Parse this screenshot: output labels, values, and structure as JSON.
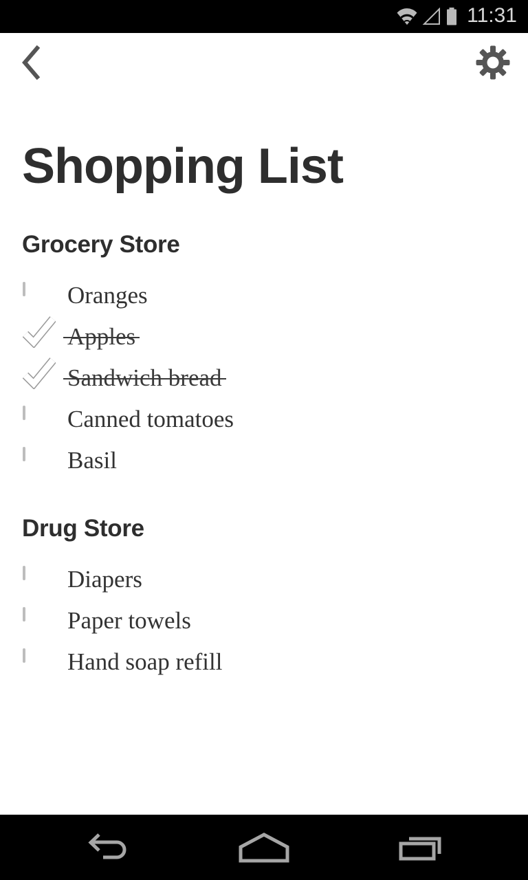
{
  "status_bar": {
    "time": "11:31",
    "icons": [
      "wifi-icon",
      "cellular-signal-icon",
      "battery-icon"
    ],
    "background": "#000000",
    "foreground": "#d8d8d8"
  },
  "app_bar": {
    "back_label": "Back",
    "back_icon": "chevron-left-icon",
    "settings_label": "Settings",
    "settings_icon": "gear-icon",
    "icon_color": "#555555"
  },
  "page": {
    "title": "Shopping List",
    "title_color": "#2e2e2e",
    "background": "#ffffff"
  },
  "sections": [
    {
      "title": "Grocery Store",
      "items": [
        {
          "label": "Oranges",
          "checked": false
        },
        {
          "label": "Apples",
          "checked": true
        },
        {
          "label": "Sandwich bread",
          "checked": true
        },
        {
          "label": "Canned tomatoes",
          "checked": false
        },
        {
          "label": "Basil",
          "checked": false
        }
      ]
    },
    {
      "title": "Drug Store",
      "items": [
        {
          "label": "Diapers",
          "checked": false
        },
        {
          "label": "Paper towels",
          "checked": false
        },
        {
          "label": "Hand soap refill",
          "checked": false
        }
      ]
    }
  ],
  "checkbox_style": {
    "unchecked_fill": "#eeeeee",
    "unchecked_border": "#bdbdbd",
    "checked_fill": "#6e6e6e",
    "check_mark": "#ffffff"
  },
  "nav_bar": {
    "background": "#000000",
    "icon_color": "#9e9e9e",
    "buttons": [
      {
        "name": "back-nav-icon",
        "label": "Back"
      },
      {
        "name": "home-nav-icon",
        "label": "Home"
      },
      {
        "name": "recents-nav-icon",
        "label": "Recent apps"
      }
    ]
  }
}
